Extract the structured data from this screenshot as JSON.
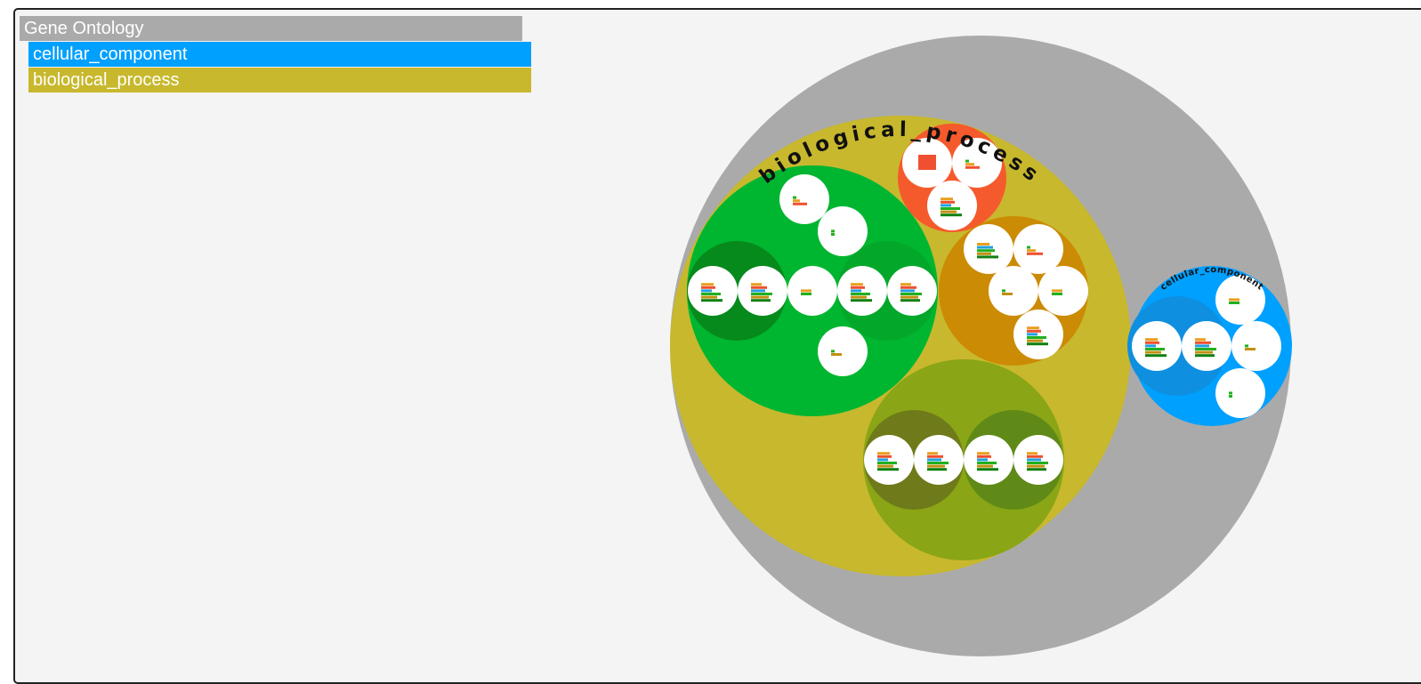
{
  "legend": {
    "items": [
      {
        "label": "Gene Ontology",
        "color": "#aaaaaa"
      },
      {
        "label": "cellular_component",
        "color": "#00a0ff"
      },
      {
        "label": "biological_process",
        "color": "#c8b82d"
      }
    ]
  },
  "diagram": {
    "root_label": "Gene Ontology",
    "root_color": "#aaaaaa",
    "leaf_color": "#ffffff",
    "bar_colors": [
      "#e8a020",
      "#f05030",
      "#20a0e0",
      "#20b020",
      "#c09010",
      "#108010"
    ],
    "groups": [
      {
        "name": "biological_process",
        "label": "biological_process",
        "color": "#c8b82d"
      },
      {
        "name": "cellular_component",
        "label": "cellular_component",
        "color": "#00a0ff"
      }
    ],
    "subgroup_colors": {
      "green": "#00b630",
      "green_dark": "#068a1c",
      "red": "#f55a2d",
      "orange": "#cc8b05",
      "olive": "#8aa515",
      "olive_dark": "#6f7a1a",
      "olive_green": "#5f8a18",
      "blue_inner": "#0e8fe0"
    }
  }
}
